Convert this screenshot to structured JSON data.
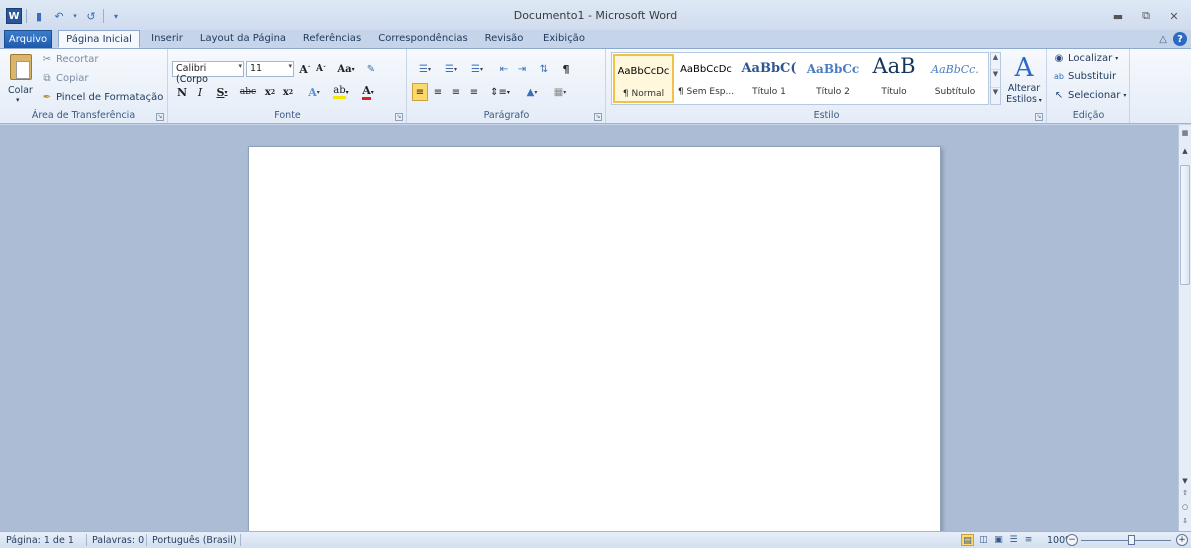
{
  "window": {
    "title": "Documento1 - Microsoft Word",
    "app_icon_letter": "W"
  },
  "tabs": [
    "Arquivo",
    "Página Inicial",
    "Inserir",
    "Layout da Página",
    "Referências",
    "Correspondências",
    "Revisão",
    "Exibição"
  ],
  "clipboard": {
    "paste_label": "Colar",
    "cut_label": "Recortar",
    "copy_label": "Copiar",
    "format_painter_label": "Pincel de Formatação",
    "group_label": "Área de Transferência"
  },
  "font": {
    "font_name": "Calibri (Corpo",
    "font_size": "11",
    "group_label": "Fonte"
  },
  "paragraph": {
    "group_label": "Parágrafo"
  },
  "styles": {
    "group_label": "Estilo",
    "items": [
      {
        "preview": "AaBbCcDc",
        "name": "¶ Normal"
      },
      {
        "preview": "AaBbCcDc",
        "name": "¶ Sem Esp..."
      },
      {
        "preview": "AaBbC(",
        "name": "Título 1"
      },
      {
        "preview": "AaBbCc",
        "name": "Título 2"
      },
      {
        "preview": "AaB",
        "name": "Título"
      },
      {
        "preview": "AaBbCc.",
        "name": "Subtítulo"
      }
    ],
    "change_styles_label_1": "Alterar",
    "change_styles_label_2": "Estilos"
  },
  "editing": {
    "find_label": "Localizar",
    "replace_label": "Substituir",
    "select_label": "Selecionar",
    "group_label": "Edição"
  },
  "status": {
    "page": "Página: 1 de 1",
    "words": "Palavras: 0",
    "language": "Português (Brasil)",
    "zoom": "100%"
  },
  "colors": {
    "accent": "#2b579a",
    "ribbon_bg": "#e4ecf7",
    "doc_bg": "#abbcd4"
  }
}
